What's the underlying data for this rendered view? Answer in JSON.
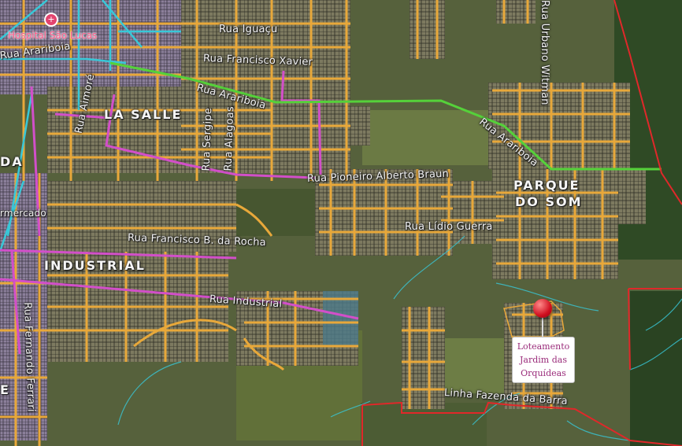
{
  "map": {
    "poi": {
      "label": "Hospital São Lucas",
      "icon": "medical-cross-icon"
    },
    "pin": {
      "icon": "map-pin-icon",
      "color": "#d01020",
      "callout": {
        "line1": "Loteamento",
        "line2": "Jardim das",
        "line3": "Orquídeas"
      }
    },
    "neighborhoods": {
      "la_salle": "LA SALLE",
      "industrial": "INDUSTRIAL",
      "parque": "PARQUE",
      "do_som": "DO SOM",
      "edge_da": "DA",
      "edge_e": "E"
    },
    "streets": {
      "iguacu": "Rua Iguaçu",
      "francisco_xavier": "Rua Francisco Xavier",
      "arariboia_left": "Rua Arariboia",
      "arariboia_mid": "Rua Arariboia",
      "arariboia_right": "Rua Arariboia",
      "aimore": "Rua Aimoré",
      "sergipe": "Rua Sergipe",
      "alagoas": "Rua Alagoas",
      "urbano_witmann": "Rua Urbano Witman",
      "pioneiro": "Rua Pioneiro Alberto Braun",
      "lidio_guerra": "Rua Lídio Guerra",
      "francisco_rocha": "Rua Francisco B. da Rocha",
      "industrial": "Rua Industrial",
      "fernando_ferrari": "Rua Fernando Ferrari",
      "linha_fazenda": "Linha Fazenda da Barra",
      "mercado": "rmercado"
    },
    "colors": {
      "arterial": "#e8a83a",
      "primary": "#d24fc9",
      "highway": "#55d13a",
      "cyan": "#38c8d8",
      "boundary": "#e0282a"
    }
  }
}
